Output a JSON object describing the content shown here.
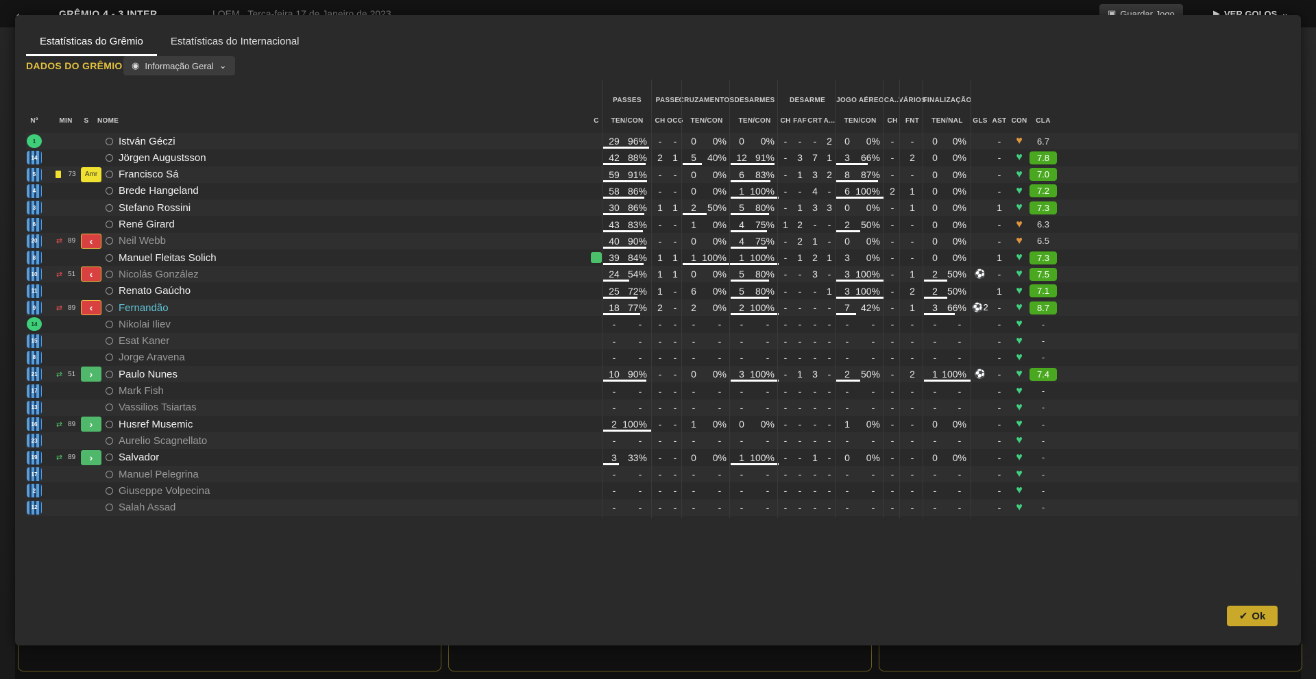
{
  "header": {
    "score": "GRÊMIO  4 - 3  INTER",
    "competition": "LOEM",
    "date": "Terça-feira 17 de Janeiro de 2023",
    "save_label": "Guardar Jogo",
    "goals_label": "VER GOLOS"
  },
  "tabs": [
    "Estatísticas do Grêmio",
    "Estatísticas do Internacional"
  ],
  "section_title": "DADOS DO GRÊMIO",
  "view_dropdown": "Informação Geral",
  "groups": [
    "PASSES",
    "PASSE",
    "CRUZAMENTOS",
    "DESARMES",
    "DESARME",
    "JOGO AÉREO",
    "CA...",
    "VÁRIOS",
    "FINALIZAÇÃO"
  ],
  "headers": {
    "num": "Nº",
    "min": "MIN",
    "s": "S",
    "name": "NOME",
    "c": "C",
    "passes": "TEN/CON",
    "passe_ch": "CH",
    "passe_ocg": "OCG",
    "cruz": "TEN/CON",
    "desarmes": "TEN/CON",
    "d_ch": "CH",
    "d_faf": "FAF",
    "d_crt": "CRT",
    "d_a": "A...",
    "aereo": "TEN/CON",
    "ca_ch": "CH",
    "fnt": "FNT",
    "fin": "TEN/NAL",
    "gls": "GLS",
    "ast": "AST",
    "con": "CON",
    "cla": "CLA"
  },
  "players": [
    {
      "num": "1",
      "gk": true,
      "min": "",
      "s": "",
      "name": "István Géczi",
      "c": "",
      "pt": "29",
      "pp": "96%",
      "pb": 0.96,
      "ch": "-",
      "ocg": "-",
      "ct": "0",
      "cp": "0%",
      "cb": 0,
      "dt": "0",
      "dp": "0%",
      "db": 0,
      "dch": "-",
      "faf": "-",
      "crt": "-",
      "da": "2",
      "at": "0",
      "ap": "0%",
      "ab": 0,
      "cach": "-",
      "fnt": "-",
      "ft": "0",
      "fp": "0%",
      "fb": 0,
      "gls": "",
      "ast": "-",
      "rating": "6.7",
      "good": false
    },
    {
      "num": "14",
      "min": "",
      "s": "",
      "name": "Jörgen Augustsson",
      "c": "",
      "pt": "42",
      "pp": "88%",
      "pb": 0.88,
      "ch": "2",
      "ocg": "1",
      "ct": "5",
      "cp": "40%",
      "cb": 0.4,
      "dt": "12",
      "dp": "91%",
      "db": 0.91,
      "dch": "-",
      "faf": "3",
      "crt": "7",
      "da": "1",
      "at": "3",
      "ap": "66%",
      "ab": 0.66,
      "cach": "-",
      "fnt": "2",
      "ft": "0",
      "fp": "0%",
      "fb": 0,
      "gls": "",
      "ast": "-",
      "rating": "7.8",
      "good": true
    },
    {
      "num": "5",
      "min": "73",
      "s": "Amr",
      "card": true,
      "name": "Francisco Sá",
      "c": "",
      "pt": "59",
      "pp": "91%",
      "pb": 0.91,
      "ch": "-",
      "ocg": "-",
      "ct": "0",
      "cp": "0%",
      "cb": 0,
      "dt": "6",
      "dp": "83%",
      "db": 0.83,
      "dch": "-",
      "faf": "1",
      "crt": "3",
      "da": "2",
      "at": "8",
      "ap": "87%",
      "ab": 0.87,
      "cach": "-",
      "fnt": "-",
      "ft": "0",
      "fp": "0%",
      "fb": 0,
      "gls": "",
      "ast": "-",
      "rating": "7.0",
      "good": true
    },
    {
      "num": "4",
      "min": "",
      "s": "",
      "name": "Brede Hangeland",
      "c": "",
      "pt": "58",
      "pp": "86%",
      "pb": 0.86,
      "ch": "-",
      "ocg": "-",
      "ct": "0",
      "cp": "0%",
      "cb": 0,
      "dt": "1",
      "dp": "100%",
      "db": 1,
      "dch": "-",
      "faf": "-",
      "crt": "4",
      "da": "-",
      "at": "6",
      "ap": "100%",
      "ab": 1,
      "cach": "2",
      "fnt": "1",
      "ft": "0",
      "fp": "0%",
      "fb": 0,
      "gls": "",
      "ast": "-",
      "rating": "7.2",
      "good": true
    },
    {
      "num": "3",
      "min": "",
      "s": "",
      "name": "Stefano Rossini",
      "c": "",
      "pt": "30",
      "pp": "86%",
      "pb": 0.86,
      "ch": "1",
      "ocg": "1",
      "ct": "2",
      "cp": "50%",
      "cb": 0.5,
      "dt": "5",
      "dp": "80%",
      "db": 0.8,
      "dch": "-",
      "faf": "1",
      "crt": "3",
      "da": "3",
      "at": "0",
      "ap": "0%",
      "ab": 0,
      "cach": "-",
      "fnt": "1",
      "ft": "0",
      "fp": "0%",
      "fb": 0,
      "gls": "",
      "ast": "1",
      "rating": "7.3",
      "good": true
    },
    {
      "num": "6",
      "min": "",
      "s": "",
      "name": "René Girard",
      "c": "",
      "pt": "43",
      "pp": "83%",
      "pb": 0.83,
      "ch": "-",
      "ocg": "-",
      "ct": "1",
      "cp": "0%",
      "cb": 0,
      "dt": "4",
      "dp": "75%",
      "db": 0.75,
      "dch": "1",
      "faf": "2",
      "crt": "-",
      "da": "-",
      "at": "2",
      "ap": "50%",
      "ab": 0.5,
      "cach": "-",
      "fnt": "-",
      "ft": "0",
      "fp": "0%",
      "fb": 0,
      "gls": "",
      "ast": "-",
      "rating": "6.3",
      "good": false
    },
    {
      "num": "20",
      "min": "89",
      "s": "out",
      "name": "Neil Webb",
      "dim": true,
      "c": "",
      "pt": "40",
      "pp": "90%",
      "pb": 0.9,
      "ch": "-",
      "ocg": "-",
      "ct": "0",
      "cp": "0%",
      "cb": 0,
      "dt": "4",
      "dp": "75%",
      "db": 0.75,
      "dch": "-",
      "faf": "2",
      "crt": "1",
      "da": "-",
      "at": "0",
      "ap": "0%",
      "ab": 0,
      "cach": "-",
      "fnt": "-",
      "ft": "0",
      "fp": "0%",
      "fb": 0,
      "gls": "",
      "ast": "-",
      "rating": "6.5",
      "good": false
    },
    {
      "num": "8",
      "min": "",
      "s": "",
      "name": "Manuel Fleitas Solich",
      "cond": true,
      "c": "",
      "pt": "39",
      "pp": "84%",
      "pb": 0.84,
      "ch": "1",
      "ocg": "1",
      "ct": "1",
      "cp": "100%",
      "cb": 1,
      "dt": "1",
      "dp": "100%",
      "db": 1,
      "dch": "-",
      "faf": "1",
      "crt": "2",
      "da": "1",
      "at": "3",
      "ap": "0%",
      "ab": 0,
      "cach": "-",
      "fnt": "-",
      "ft": "0",
      "fp": "0%",
      "fb": 0,
      "gls": "",
      "ast": "1",
      "rating": "7.3",
      "good": true
    },
    {
      "num": "10",
      "min": "51",
      "s": "out",
      "name": "Nicolás González",
      "dim": true,
      "c": "",
      "pt": "24",
      "pp": "54%",
      "pb": 0.54,
      "ch": "1",
      "ocg": "1",
      "ct": "0",
      "cp": "0%",
      "cb": 0,
      "dt": "5",
      "dp": "80%",
      "db": 0.8,
      "dch": "-",
      "faf": "-",
      "crt": "3",
      "da": "-",
      "at": "3",
      "ap": "100%",
      "ab": 1,
      "cach": "-",
      "fnt": "1",
      "ft": "2",
      "fp": "50%",
      "fb": 0.5,
      "gls": "ball",
      "ast": "-",
      "rating": "7.5",
      "good": true
    },
    {
      "num": "11",
      "min": "",
      "s": "",
      "name": "Renato Gaúcho",
      "c": "",
      "pt": "25",
      "pp": "72%",
      "pb": 0.72,
      "ch": "1",
      "ocg": "-",
      "ct": "6",
      "cp": "0%",
      "cb": 0,
      "dt": "5",
      "dp": "80%",
      "db": 0.8,
      "dch": "-",
      "faf": "-",
      "crt": "-",
      "da": "1",
      "at": "3",
      "ap": "100%",
      "ab": 1,
      "cach": "-",
      "fnt": "2",
      "ft": "2",
      "fp": "50%",
      "fb": 0.5,
      "gls": "",
      "ast": "1",
      "rating": "7.1",
      "good": true
    },
    {
      "num": "9",
      "min": "89",
      "s": "out",
      "name": "Fernandão",
      "hl": true,
      "c": "",
      "pt": "18",
      "pp": "77%",
      "pb": 0.77,
      "ch": "2",
      "ocg": "-",
      "ct": "2",
      "cp": "0%",
      "cb": 0,
      "dt": "2",
      "dp": "100%",
      "db": 1,
      "dch": "-",
      "faf": "-",
      "crt": "-",
      "da": "-",
      "at": "7",
      "ap": "42%",
      "ab": 0.42,
      "cach": "-",
      "fnt": "1",
      "ft": "3",
      "fp": "66%",
      "fb": 0.66,
      "gls": "ball2",
      "ast": "-",
      "rating": "8.7",
      "good": true
    },
    {
      "num": "14",
      "gk": true,
      "min": "",
      "s": "",
      "name": "Nikolai Iliev",
      "dim": true,
      "unused": true,
      "rating": "-"
    },
    {
      "num": "15",
      "min": "",
      "s": "",
      "name": "Esat Kaner",
      "dim": true,
      "unused": true,
      "rating": "-"
    },
    {
      "num": "8",
      "min": "",
      "s": "",
      "name": "Jorge Aravena",
      "dim": true,
      "unused": true,
      "rating": "-"
    },
    {
      "num": "21",
      "min": "51",
      "s": "in",
      "name": "Paulo Nunes",
      "c": "",
      "pt": "10",
      "pp": "90%",
      "pb": 0.9,
      "ch": "-",
      "ocg": "-",
      "ct": "0",
      "cp": "0%",
      "cb": 0,
      "dt": "3",
      "dp": "100%",
      "db": 1,
      "dch": "-",
      "faf": "1",
      "crt": "3",
      "da": "-",
      "at": "2",
      "ap": "50%",
      "ab": 0.5,
      "cach": "-",
      "fnt": "2",
      "ft": "1",
      "fp": "100%",
      "fb": 1,
      "gls": "ball",
      "ast": "-",
      "rating": "7.4",
      "good": true
    },
    {
      "num": "17",
      "min": "",
      "s": "",
      "name": "Mark Fish",
      "dim": true,
      "unused": true,
      "rating": "-"
    },
    {
      "num": "13",
      "min": "",
      "s": "",
      "name": "Vassilios Tsiartas",
      "dim": true,
      "unused": true,
      "rating": "-"
    },
    {
      "num": "16",
      "min": "89",
      "s": "in",
      "name": "Husref Musemic",
      "c": "",
      "pt": "2",
      "pp": "100%",
      "pb": 1,
      "ch": "-",
      "ocg": "-",
      "ct": "1",
      "cp": "0%",
      "cb": 0,
      "dt": "0",
      "dp": "0%",
      "db": 0,
      "dch": "-",
      "faf": "-",
      "crt": "-",
      "da": "-",
      "at": "1",
      "ap": "0%",
      "ab": 0,
      "cach": "-",
      "fnt": "-",
      "ft": "0",
      "fp": "0%",
      "fb": 0,
      "gls": "",
      "ast": "-",
      "rating": "-",
      "good": false
    },
    {
      "num": "23",
      "min": "",
      "s": "",
      "name": "Aurelio Scagnellato",
      "dim": true,
      "unused": true,
      "rating": "-"
    },
    {
      "num": "19",
      "min": "89",
      "s": "in",
      "name": "Salvador",
      "c": "",
      "pt": "3",
      "pp": "33%",
      "pb": 0.33,
      "ch": "-",
      "ocg": "-",
      "ct": "0",
      "cp": "0%",
      "cb": 0,
      "dt": "1",
      "dp": "100%",
      "db": 1,
      "dch": "-",
      "faf": "-",
      "crt": "1",
      "da": "-",
      "at": "0",
      "ap": "0%",
      "ab": 0,
      "cach": "-",
      "fnt": "-",
      "ft": "0",
      "fp": "0%",
      "fb": 0,
      "gls": "",
      "ast": "-",
      "rating": "-",
      "good": false
    },
    {
      "num": "17",
      "min": "",
      "s": "",
      "name": "Manuel Pelegrina",
      "dim": true,
      "unused": true,
      "rating": "-"
    },
    {
      "num": "2",
      "min": "",
      "s": "",
      "name": "Giuseppe Volpecina",
      "dim": true,
      "unused": true,
      "rating": "-"
    },
    {
      "num": "12",
      "min": "",
      "s": "",
      "name": "Salah Assad",
      "dim": true,
      "unused": true,
      "rating": "-"
    }
  ],
  "ok_label": "Ok",
  "colors": {
    "accent": "#e3c23f",
    "good_rating": "#4aa820",
    "sub_out": "#d94040",
    "sub_in": "#4fb86a",
    "heart": "#40d080"
  }
}
